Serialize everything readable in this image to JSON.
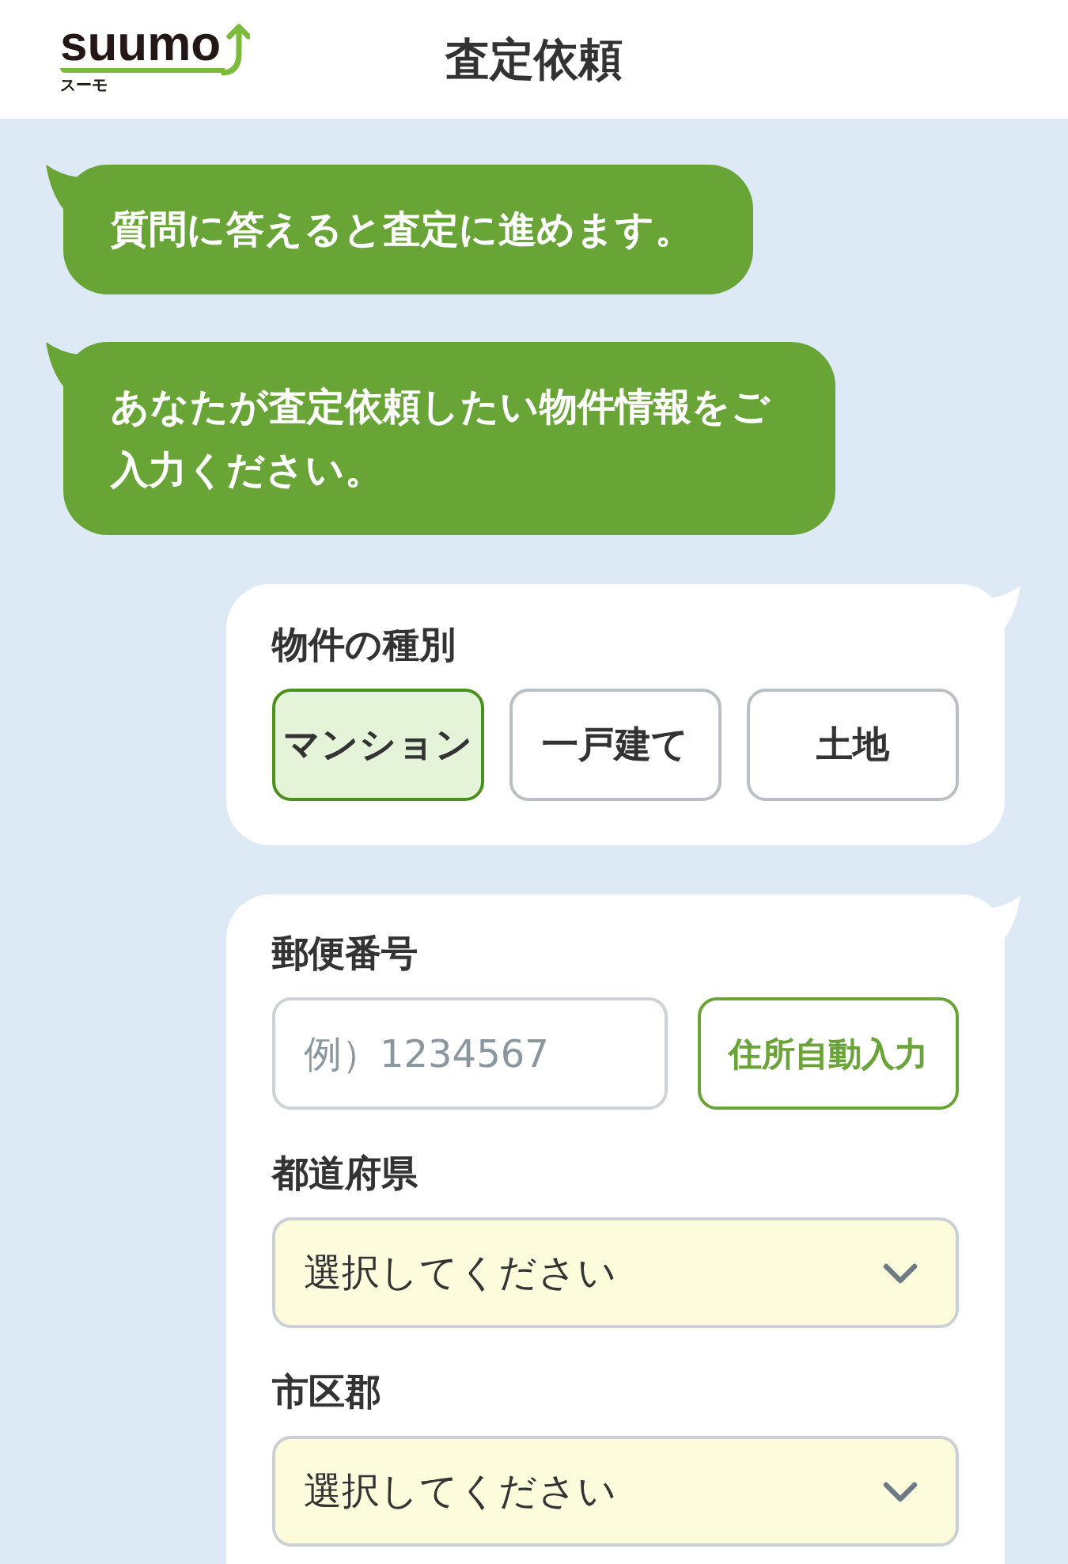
{
  "header": {
    "logo": {
      "wordmark": "suumo",
      "kana": "スーモ"
    },
    "title": "査定依頼"
  },
  "messages": [
    {
      "text": "質問に答えると査定に進めます。"
    },
    {
      "text": "あなたが査定依頼したい物件情報をご入力ください。"
    }
  ],
  "property_type": {
    "label": "物件の種別",
    "options": [
      {
        "label": "マンション",
        "selected": true
      },
      {
        "label": "一戸建て",
        "selected": false
      },
      {
        "label": "土地",
        "selected": false
      }
    ]
  },
  "address_form": {
    "fields": [
      {
        "kind": "postal",
        "label": "郵便番号",
        "placeholder": "例）1234567",
        "button": "住所自動入力"
      },
      {
        "kind": "select",
        "label": "都道府県",
        "value": "選択してください"
      },
      {
        "kind": "select",
        "label": "市区郡",
        "value": "選択してください"
      }
    ]
  }
}
